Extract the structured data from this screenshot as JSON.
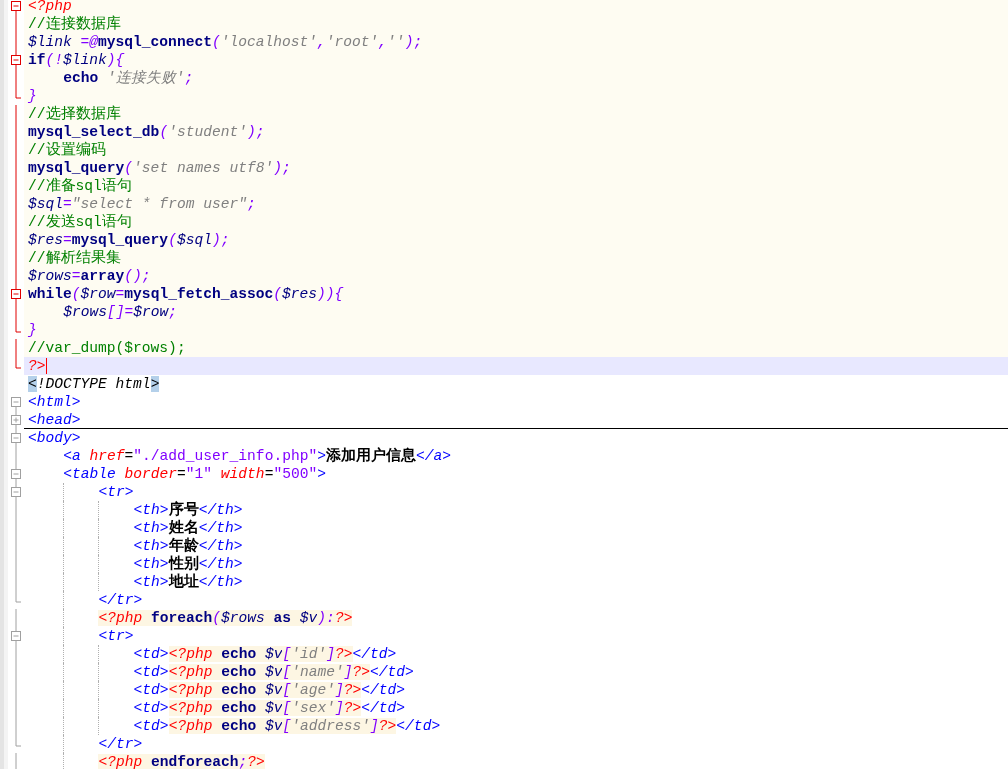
{
  "lines": [
    {
      "kind": "zero",
      "marker": {
        "kind": "open",
        "active": true
      },
      "php": true,
      "current": false,
      "cursor": false,
      "tokens": [
        {
          "kind": "phptag",
          "text": "<?php",
          "php": false
        }
      ]
    },
    {
      "kind": "zero",
      "marker": {
        "kind": "line",
        "active": true
      },
      "php": true,
      "current": false,
      "cursor": false,
      "tokens": [
        {
          "kind": "comment",
          "text": "//连接数据库",
          "php": false
        }
      ]
    },
    {
      "kind": "zero",
      "marker": {
        "kind": "line",
        "active": true
      },
      "php": true,
      "current": false,
      "cursor": false,
      "tokens": [
        {
          "kind": "var",
          "text": "$link ",
          "php": false
        },
        {
          "kind": "op",
          "text": "=@",
          "php": false
        },
        {
          "kind": "func",
          "text": "mysql_connect",
          "php": false
        },
        {
          "kind": "op",
          "text": "(",
          "php": false
        },
        {
          "kind": "string",
          "text": "'localhost'",
          "php": false
        },
        {
          "kind": "op",
          "text": ",",
          "php": false
        },
        {
          "kind": "string",
          "text": "'root'",
          "php": false
        },
        {
          "kind": "op",
          "text": ",",
          "php": false
        },
        {
          "kind": "string",
          "text": "''",
          "php": false
        },
        {
          "kind": "op",
          "text": ");",
          "php": false
        }
      ]
    },
    {
      "kind": "zero",
      "marker": {
        "kind": "open",
        "active": true
      },
      "php": true,
      "current": false,
      "cursor": false,
      "tokens": [
        {
          "kind": "func",
          "text": "if",
          "php": false
        },
        {
          "kind": "op",
          "text": "(!",
          "php": false
        },
        {
          "kind": "var",
          "text": "$link",
          "php": false
        },
        {
          "kind": "op",
          "text": "){",
          "php": false
        }
      ]
    },
    {
      "kind": "one",
      "marker": {
        "kind": "line",
        "active": true
      },
      "php": true,
      "current": false,
      "cursor": false,
      "tokens": [
        {
          "kind": "func",
          "text": "echo ",
          "php": false
        },
        {
          "kind": "string",
          "text": "'连接失败'",
          "php": false
        },
        {
          "kind": "op",
          "text": ";",
          "php": false
        }
      ]
    },
    {
      "kind": "zero",
      "marker": {
        "kind": "end",
        "active": true
      },
      "php": true,
      "current": false,
      "cursor": false,
      "tokens": [
        {
          "kind": "op",
          "text": "}",
          "php": false
        }
      ]
    },
    {
      "kind": "zero",
      "marker": {
        "kind": "line",
        "active": true
      },
      "php": true,
      "current": false,
      "cursor": false,
      "tokens": [
        {
          "kind": "comment",
          "text": "//选择数据库",
          "php": false
        }
      ]
    },
    {
      "kind": "zero",
      "marker": {
        "kind": "line",
        "active": true
      },
      "php": true,
      "current": false,
      "cursor": false,
      "tokens": [
        {
          "kind": "func",
          "text": "mysql_select_db",
          "php": false
        },
        {
          "kind": "op",
          "text": "(",
          "php": false
        },
        {
          "kind": "string",
          "text": "'student'",
          "php": false
        },
        {
          "kind": "op",
          "text": ");",
          "php": false
        }
      ]
    },
    {
      "kind": "zero",
      "marker": {
        "kind": "line",
        "active": true
      },
      "php": true,
      "current": false,
      "cursor": false,
      "tokens": [
        {
          "kind": "comment",
          "text": "//设置编码",
          "php": false
        }
      ]
    },
    {
      "kind": "zero",
      "marker": {
        "kind": "line",
        "active": true
      },
      "php": true,
      "current": false,
      "cursor": false,
      "tokens": [
        {
          "kind": "func",
          "text": "mysql_query",
          "php": false
        },
        {
          "kind": "op",
          "text": "(",
          "php": false
        },
        {
          "kind": "string",
          "text": "'set names utf8'",
          "php": false
        },
        {
          "kind": "op",
          "text": ");",
          "php": false
        }
      ]
    },
    {
      "kind": "zero",
      "marker": {
        "kind": "line",
        "active": true
      },
      "php": true,
      "current": false,
      "cursor": false,
      "tokens": [
        {
          "kind": "comment",
          "text": "//准备sql语句",
          "php": false
        }
      ]
    },
    {
      "kind": "zero",
      "marker": {
        "kind": "line",
        "active": true
      },
      "php": true,
      "current": false,
      "cursor": false,
      "tokens": [
        {
          "kind": "var",
          "text": "$sql",
          "php": false
        },
        {
          "kind": "op",
          "text": "=",
          "php": false
        },
        {
          "kind": "string",
          "text": "\"select * from user\"",
          "php": false
        },
        {
          "kind": "op",
          "text": ";",
          "php": false
        }
      ]
    },
    {
      "kind": "zero",
      "marker": {
        "kind": "line",
        "active": true
      },
      "php": true,
      "current": false,
      "cursor": false,
      "tokens": [
        {
          "kind": "comment",
          "text": "//发送sql语句",
          "php": false
        }
      ]
    },
    {
      "kind": "zero",
      "marker": {
        "kind": "line",
        "active": true
      },
      "php": true,
      "current": false,
      "cursor": false,
      "tokens": [
        {
          "kind": "var",
          "text": "$res",
          "php": false
        },
        {
          "kind": "op",
          "text": "=",
          "php": false
        },
        {
          "kind": "func",
          "text": "mysql_query",
          "php": false
        },
        {
          "kind": "op",
          "text": "(",
          "php": false
        },
        {
          "kind": "var",
          "text": "$sql",
          "php": false
        },
        {
          "kind": "op",
          "text": ");",
          "php": false
        }
      ]
    },
    {
      "kind": "zero",
      "marker": {
        "kind": "line",
        "active": true
      },
      "php": true,
      "current": false,
      "cursor": false,
      "tokens": [
        {
          "kind": "comment",
          "text": "//解析结果集",
          "php": false
        }
      ]
    },
    {
      "kind": "zero",
      "marker": {
        "kind": "line",
        "active": true
      },
      "php": true,
      "current": false,
      "cursor": false,
      "tokens": [
        {
          "kind": "var",
          "text": "$rows",
          "php": false
        },
        {
          "kind": "op",
          "text": "=",
          "php": false
        },
        {
          "kind": "func",
          "text": "array",
          "php": false
        },
        {
          "kind": "op",
          "text": "();",
          "php": false
        }
      ]
    },
    {
      "kind": "zero",
      "marker": {
        "kind": "open",
        "active": true
      },
      "php": true,
      "current": false,
      "cursor": false,
      "tokens": [
        {
          "kind": "func",
          "text": "while",
          "php": false
        },
        {
          "kind": "op",
          "text": "(",
          "php": false
        },
        {
          "kind": "var",
          "text": "$row",
          "php": false
        },
        {
          "kind": "op",
          "text": "=",
          "php": false
        },
        {
          "kind": "func",
          "text": "mysql_fetch_assoc",
          "php": false
        },
        {
          "kind": "op",
          "text": "(",
          "php": false
        },
        {
          "kind": "var",
          "text": "$res",
          "php": false
        },
        {
          "kind": "op",
          "text": ")){",
          "php": false
        }
      ]
    },
    {
      "kind": "one",
      "marker": {
        "kind": "line",
        "active": true
      },
      "php": true,
      "current": false,
      "cursor": false,
      "tokens": [
        {
          "kind": "var",
          "text": "$rows",
          "php": false
        },
        {
          "kind": "op",
          "text": "[]=",
          "php": false
        },
        {
          "kind": "var",
          "text": "$row",
          "php": false
        },
        {
          "kind": "op",
          "text": ";",
          "php": false
        }
      ]
    },
    {
      "kind": "zero",
      "marker": {
        "kind": "end",
        "active": true
      },
      "php": true,
      "current": false,
      "cursor": false,
      "tokens": [
        {
          "kind": "op",
          "text": "}",
          "php": false
        }
      ]
    },
    {
      "kind": "zero",
      "marker": {
        "kind": "line",
        "active": true
      },
      "php": true,
      "current": false,
      "cursor": false,
      "tokens": [
        {
          "kind": "comment",
          "text": "//var_dump($rows);",
          "php": false
        }
      ]
    },
    {
      "kind": "zero",
      "marker": {
        "kind": "end",
        "active": true
      },
      "current": true,
      "cursor": true,
      "tokens": [
        {
          "kind": "phptag",
          "text": "?>",
          "php": false
        }
      ]
    },
    {
      "kind": "zero",
      "marker": {
        "kind": "none"
      },
      "php": false,
      "current": false,
      "cursor": false,
      "tokens": [
        {
          "kind": "doctype",
          "text": "<",
          "php": false,
          "match": true
        },
        {
          "kind": "doctype",
          "text": "!DOCTYPE html",
          "php": false,
          "match": false
        },
        {
          "kind": "doctype",
          "text": ">",
          "php": false,
          "match": true
        }
      ]
    },
    {
      "kind": "zero",
      "marker": {
        "kind": "open",
        "active": false
      },
      "php": false,
      "current": false,
      "cursor": false,
      "tokens": [
        {
          "kind": "tag",
          "text": "<html>",
          "php": false
        }
      ]
    },
    {
      "kind": "zero",
      "marker": {
        "kind": "closed",
        "active": false
      },
      "php": false,
      "current": false,
      "cursor": false,
      "tokens": [
        {
          "kind": "tag",
          "text": "<head>",
          "php": false
        }
      ]
    },
    {
      "kind": "zero",
      "marker": {
        "kind": "open",
        "active": false
      },
      "php": false,
      "current": false,
      "cursor": false,
      "tokens": [
        {
          "kind": "tag",
          "text": "<body>",
          "php": false
        }
      ]
    },
    {
      "kind": "one",
      "marker": {
        "kind": "line",
        "active": false
      },
      "php": false,
      "current": false,
      "cursor": false,
      "tokens": [
        {
          "kind": "tag",
          "text": "<a ",
          "php": false
        },
        {
          "kind": "attr",
          "text": "href",
          "php": false
        },
        {
          "kind": "plain",
          "text": "=",
          "php": false
        },
        {
          "kind": "attrval",
          "text": "\"./add_user_info.php\"",
          "php": false
        },
        {
          "kind": "tag",
          "text": ">",
          "php": false
        },
        {
          "kind": "text",
          "text": "添加用户信息",
          "php": false
        },
        {
          "kind": "tag",
          "text": "</a>",
          "php": false
        }
      ]
    },
    {
      "kind": "one",
      "marker": {
        "kind": "open",
        "active": false
      },
      "php": false,
      "current": false,
      "cursor": false,
      "tokens": [
        {
          "kind": "tag",
          "text": "<table ",
          "php": false
        },
        {
          "kind": "attr",
          "text": "border",
          "php": false
        },
        {
          "kind": "plain",
          "text": "=",
          "php": false
        },
        {
          "kind": "attrval",
          "text": "\"1\" ",
          "php": false
        },
        {
          "kind": "attr",
          "text": "width",
          "php": false
        },
        {
          "kind": "plain",
          "text": "=",
          "php": false
        },
        {
          "kind": "attrval",
          "text": "\"500\"",
          "php": false
        },
        {
          "kind": "tag",
          "text": ">",
          "php": false
        }
      ]
    },
    {
      "kind": "two",
      "marker": {
        "kind": "open",
        "active": false
      },
      "php": false,
      "current": false,
      "cursor": false,
      "tokens": [
        {
          "kind": "tag",
          "text": "<tr>",
          "php": false
        }
      ]
    },
    {
      "kind": "three",
      "marker": {
        "kind": "line",
        "active": false
      },
      "php": false,
      "current": false,
      "cursor": false,
      "tokens": [
        {
          "kind": "tag",
          "text": "<th>",
          "php": false
        },
        {
          "kind": "text",
          "text": "序号",
          "php": false
        },
        {
          "kind": "tag",
          "text": "</th>",
          "php": false
        }
      ]
    },
    {
      "kind": "three",
      "marker": {
        "kind": "line",
        "active": false
      },
      "php": false,
      "current": false,
      "cursor": false,
      "tokens": [
        {
          "kind": "tag",
          "text": "<th>",
          "php": false
        },
        {
          "kind": "text",
          "text": "姓名",
          "php": false
        },
        {
          "kind": "tag",
          "text": "</th>",
          "php": false
        }
      ]
    },
    {
      "kind": "three",
      "marker": {
        "kind": "line",
        "active": false
      },
      "php": false,
      "current": false,
      "cursor": false,
      "tokens": [
        {
          "kind": "tag",
          "text": "<th>",
          "php": false
        },
        {
          "kind": "text",
          "text": "年龄",
          "php": false
        },
        {
          "kind": "tag",
          "text": "</th>",
          "php": false
        }
      ]
    },
    {
      "kind": "three",
      "marker": {
        "kind": "line",
        "active": false
      },
      "php": false,
      "current": false,
      "cursor": false,
      "tokens": [
        {
          "kind": "tag",
          "text": "<th>",
          "php": false
        },
        {
          "kind": "text",
          "text": "性别",
          "php": false
        },
        {
          "kind": "tag",
          "text": "</th>",
          "php": false
        }
      ]
    },
    {
      "kind": "three",
      "marker": {
        "kind": "line",
        "active": false
      },
      "php": false,
      "current": false,
      "cursor": false,
      "tokens": [
        {
          "kind": "tag",
          "text": "<th>",
          "php": false
        },
        {
          "kind": "text",
          "text": "地址",
          "php": false
        },
        {
          "kind": "tag",
          "text": "</th>",
          "php": false
        }
      ]
    },
    {
      "kind": "two",
      "marker": {
        "kind": "end",
        "active": false
      },
      "php": false,
      "current": false,
      "cursor": false,
      "tokens": [
        {
          "kind": "tag",
          "text": "</tr>",
          "php": false
        }
      ]
    },
    {
      "kind": "two",
      "marker": {
        "kind": "line",
        "active": false
      },
      "php": false,
      "current": false,
      "cursor": false,
      "tokens": [
        {
          "kind": "phptag",
          "text": "<?php ",
          "php": true
        },
        {
          "kind": "func",
          "text": "foreach",
          "php": true
        },
        {
          "kind": "op",
          "text": "(",
          "php": true
        },
        {
          "kind": "var",
          "text": "$rows ",
          "php": true
        },
        {
          "kind": "func",
          "text": "as ",
          "php": true
        },
        {
          "kind": "var",
          "text": "$v",
          "php": true
        },
        {
          "kind": "op",
          "text": "):",
          "php": true
        },
        {
          "kind": "phptag",
          "text": "?>",
          "php": true
        }
      ]
    },
    {
      "kind": "two",
      "marker": {
        "kind": "open",
        "active": false
      },
      "php": false,
      "current": false,
      "cursor": false,
      "tokens": [
        {
          "kind": "tag",
          "text": "<tr>",
          "php": false
        }
      ]
    },
    {
      "kind": "three",
      "marker": {
        "kind": "line",
        "active": false
      },
      "php": false,
      "current": false,
      "cursor": false,
      "tokens": [
        {
          "kind": "tag",
          "text": "<td>",
          "php": false
        },
        {
          "kind": "phptag",
          "text": "<?php ",
          "php": true
        },
        {
          "kind": "func",
          "text": "echo ",
          "php": true
        },
        {
          "kind": "var",
          "text": "$v",
          "php": true
        },
        {
          "kind": "op",
          "text": "[",
          "php": true
        },
        {
          "kind": "string",
          "text": "'id'",
          "php": true
        },
        {
          "kind": "op",
          "text": "]",
          "php": true
        },
        {
          "kind": "phptag",
          "text": "?>",
          "php": true
        },
        {
          "kind": "tag",
          "text": "</td>",
          "php": false
        }
      ]
    },
    {
      "kind": "three",
      "marker": {
        "kind": "line",
        "active": false
      },
      "php": false,
      "current": false,
      "cursor": false,
      "tokens": [
        {
          "kind": "tag",
          "text": "<td>",
          "php": false
        },
        {
          "kind": "phptag",
          "text": "<?php ",
          "php": true
        },
        {
          "kind": "func",
          "text": "echo ",
          "php": true
        },
        {
          "kind": "var",
          "text": "$v",
          "php": true
        },
        {
          "kind": "op",
          "text": "[",
          "php": true
        },
        {
          "kind": "string",
          "text": "'name'",
          "php": true
        },
        {
          "kind": "op",
          "text": "]",
          "php": true
        },
        {
          "kind": "phptag",
          "text": "?>",
          "php": true
        },
        {
          "kind": "tag",
          "text": "</td>",
          "php": false
        }
      ]
    },
    {
      "kind": "three",
      "marker": {
        "kind": "line",
        "active": false
      },
      "php": false,
      "current": false,
      "cursor": false,
      "tokens": [
        {
          "kind": "tag",
          "text": "<td>",
          "php": false
        },
        {
          "kind": "phptag",
          "text": "<?php ",
          "php": true
        },
        {
          "kind": "func",
          "text": "echo ",
          "php": true
        },
        {
          "kind": "var",
          "text": "$v",
          "php": true
        },
        {
          "kind": "op",
          "text": "[",
          "php": true
        },
        {
          "kind": "string",
          "text": "'age'",
          "php": true
        },
        {
          "kind": "op",
          "text": "]",
          "php": true
        },
        {
          "kind": "phptag",
          "text": "?>",
          "php": true
        },
        {
          "kind": "tag",
          "text": "</td>",
          "php": false
        }
      ]
    },
    {
      "kind": "three",
      "marker": {
        "kind": "line",
        "active": false
      },
      "php": false,
      "current": false,
      "cursor": false,
      "tokens": [
        {
          "kind": "tag",
          "text": "<td>",
          "php": false
        },
        {
          "kind": "phptag",
          "text": "<?php ",
          "php": true
        },
        {
          "kind": "func",
          "text": "echo ",
          "php": true
        },
        {
          "kind": "var",
          "text": "$v",
          "php": true
        },
        {
          "kind": "op",
          "text": "[",
          "php": true
        },
        {
          "kind": "string",
          "text": "'sex'",
          "php": true
        },
        {
          "kind": "op",
          "text": "]",
          "php": true
        },
        {
          "kind": "phptag",
          "text": "?>",
          "php": true
        },
        {
          "kind": "tag",
          "text": "</td>",
          "php": false
        }
      ]
    },
    {
      "kind": "three",
      "marker": {
        "kind": "line",
        "active": false
      },
      "php": false,
      "current": false,
      "cursor": false,
      "tokens": [
        {
          "kind": "tag",
          "text": "<td>",
          "php": false
        },
        {
          "kind": "phptag",
          "text": "<?php ",
          "php": true
        },
        {
          "kind": "func",
          "text": "echo ",
          "php": true
        },
        {
          "kind": "var",
          "text": "$v",
          "php": true
        },
        {
          "kind": "op",
          "text": "[",
          "php": true
        },
        {
          "kind": "string",
          "text": "'address'",
          "php": true
        },
        {
          "kind": "op",
          "text": "]",
          "php": true
        },
        {
          "kind": "phptag",
          "text": "?>",
          "php": true
        },
        {
          "kind": "tag",
          "text": "</td>",
          "php": false
        }
      ]
    },
    {
      "kind": "two",
      "marker": {
        "kind": "end",
        "active": false
      },
      "php": false,
      "current": false,
      "cursor": false,
      "tokens": [
        {
          "kind": "tag",
          "text": "</tr>",
          "php": false
        }
      ]
    },
    {
      "kind": "two",
      "marker": {
        "kind": "line",
        "active": false
      },
      "php": false,
      "current": false,
      "cursor": false,
      "tokens": [
        {
          "kind": "phptag",
          "text": "<?php ",
          "php": true
        },
        {
          "kind": "func",
          "text": "endforeach",
          "php": true
        },
        {
          "kind": "op",
          "text": ";",
          "php": true
        },
        {
          "kind": "phptag",
          "text": "?>",
          "php": true
        }
      ]
    }
  ]
}
